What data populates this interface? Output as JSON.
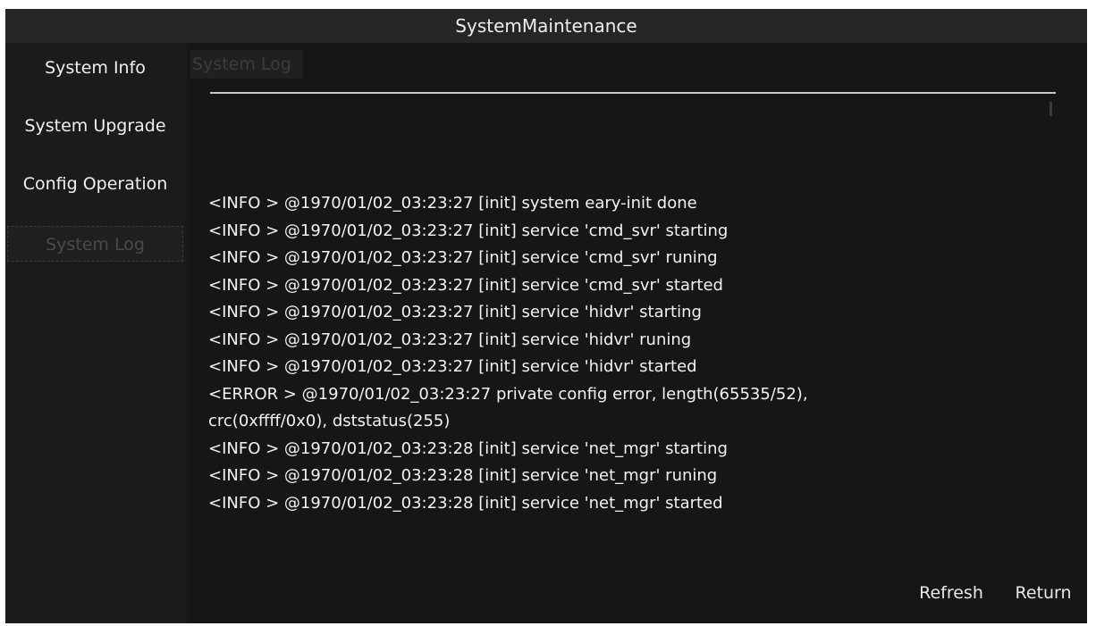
{
  "window": {
    "title": "SystemMaintenance"
  },
  "sidebar": {
    "items": [
      {
        "label": "System Info"
      },
      {
        "label": "System Upgrade"
      },
      {
        "label": "Config Operation"
      },
      {
        "label": "System Log"
      }
    ]
  },
  "main": {
    "tab_label": "System Log",
    "log_lines": [
      "<INFO  > @1970/01/02_03:23:27 [init] system eary-init done",
      "<INFO  > @1970/01/02_03:23:27 [init] service 'cmd_svr' starting",
      "<INFO  > @1970/01/02_03:23:27 [init] service 'cmd_svr' runing",
      "<INFO  > @1970/01/02_03:23:27 [init] service 'cmd_svr' started",
      "<INFO  > @1970/01/02_03:23:27 [init] service 'hidvr' starting",
      "<INFO  > @1970/01/02_03:23:27 [init] service 'hidvr' runing",
      "<INFO  > @1970/01/02_03:23:27 [init] service 'hidvr' started",
      "<ERROR > @1970/01/02_03:23:27 private config error, length(65535/52),",
      "crc(0xffff/0x0), dststatus(255)",
      "<INFO  > @1970/01/02_03:23:28 [init] service 'net_mgr' starting",
      "<INFO  > @1970/01/02_03:23:28 [init] service 'net_mgr' runing",
      "<INFO  > @1970/01/02_03:23:28 [init] service 'net_mgr' started"
    ]
  },
  "buttons": {
    "refresh": "Refresh",
    "return": "Return"
  }
}
